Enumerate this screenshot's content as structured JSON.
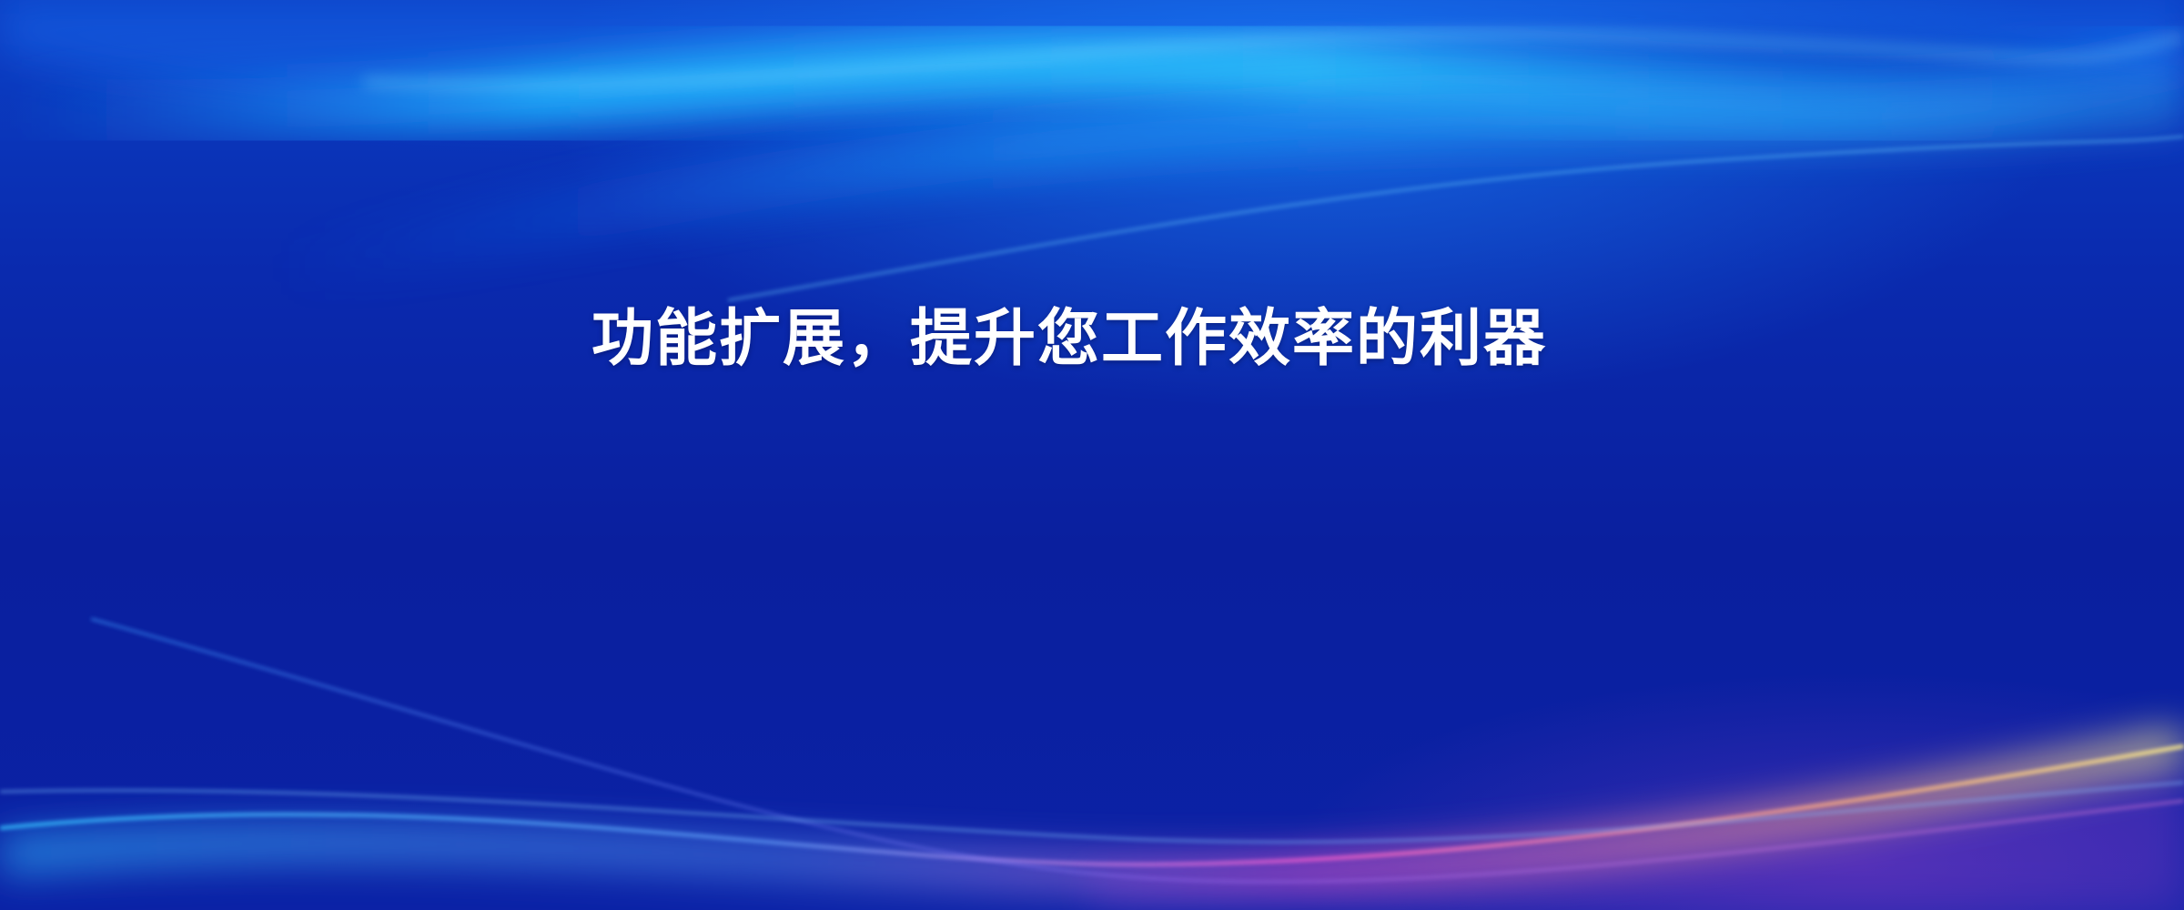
{
  "banner": {
    "headline": "功能扩展，提升您工作效率的利器",
    "colors": {
      "background_top": "#0b3fc4",
      "background_mid": "#0a1f9e",
      "light_cyan": "#29c8ff",
      "light_pink": "#ff6ad5",
      "light_yellow": "#ffe27a",
      "text": "#ffffff"
    }
  }
}
